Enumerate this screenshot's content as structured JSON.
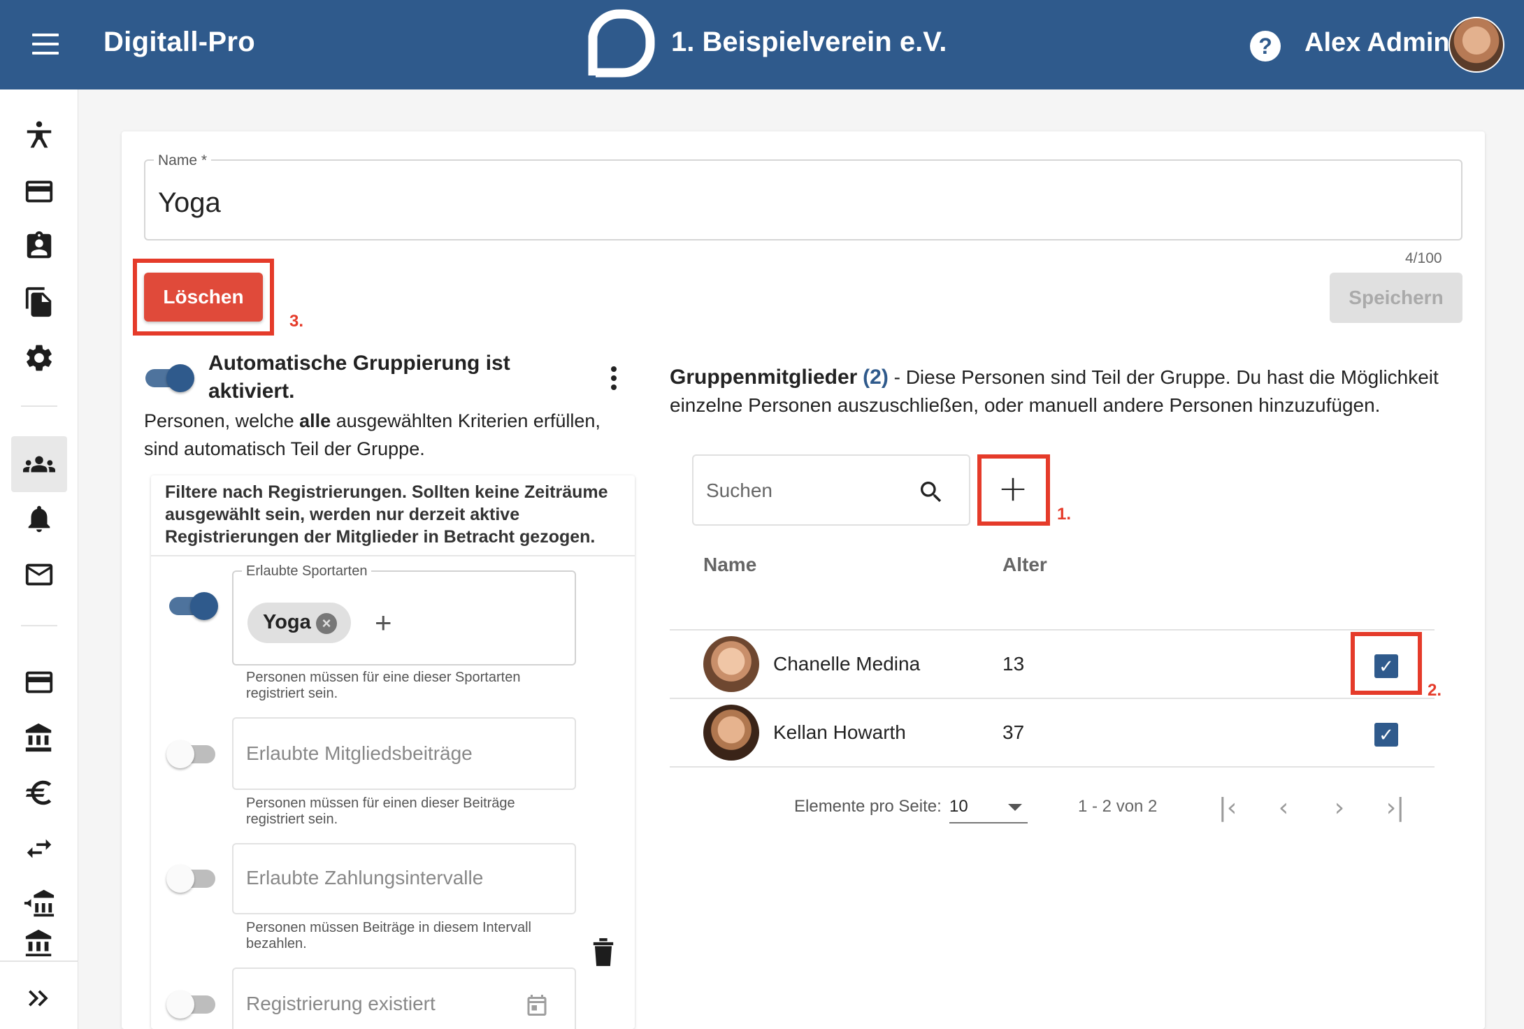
{
  "header": {
    "app_title": "Digitall-Pro",
    "club_name": "1. Beispielverein e.V.",
    "user_name": "Alex Admin",
    "help_symbol": "?",
    "brand_color": "#2f5a8c"
  },
  "sidebar": {
    "items": [
      {
        "icon": "sport-person-icon"
      },
      {
        "icon": "credit-card-icon"
      },
      {
        "icon": "contact-badge-icon"
      },
      {
        "icon": "documents-icon"
      },
      {
        "icon": "gear-icon"
      },
      {
        "icon": "groups-icon",
        "active": true
      },
      {
        "icon": "bell-icon"
      },
      {
        "icon": "mail-icon"
      },
      {
        "icon": "credit-card-icon"
      },
      {
        "icon": "bank-icon"
      },
      {
        "icon": "euro-icon"
      },
      {
        "icon": "transfer-arrows-icon"
      },
      {
        "icon": "bank-import-icon"
      },
      {
        "icon": "bank-export-icon"
      }
    ],
    "expand_icon": "double-chevron-right-icon"
  },
  "form": {
    "name_label": "Name *",
    "name_value": "Yoga",
    "counter": "4/100",
    "delete_label": "Löschen",
    "save_label": "Speichern"
  },
  "annotations": {
    "add": "1.",
    "checkbox": "2.",
    "delete": "3.",
    "color": "#e53b2a"
  },
  "auto_grouping": {
    "enabled": true,
    "title": "Automatische Gruppierung ist aktiviert.",
    "desc_pre": "Personen, welche ",
    "desc_bold": "alle",
    "desc_post": " ausgewählten Kriterien erfüllen, sind automatisch Teil der Gruppe.",
    "filter_note": "Filtere nach Registrierungen. Sollten keine Zeiträume ausgewählt sein, werden nur derzeit aktive Registrierungen der Mitglieder in Betracht gezogen.",
    "filters": [
      {
        "label": "Erlaubte Sportarten",
        "enabled": true,
        "chips": [
          "Yoga"
        ],
        "hint": "Personen müssen für eine dieser Sportarten registriert sein."
      },
      {
        "placeholder": "Erlaubte Mitgliedsbeiträge",
        "enabled": false,
        "hint": "Personen müssen für einen dieser Beiträge registriert sein."
      },
      {
        "placeholder": "Erlaubte Zahlungsintervalle",
        "enabled": false,
        "hint": "Personen müssen Beiträge in diesem Intervall bezahlen."
      },
      {
        "placeholder": "Registrierung existiert",
        "enabled": false
      }
    ]
  },
  "members": {
    "title": "Gruppenmitglieder",
    "count": "(2)",
    "description": " - Diese Personen sind Teil der Gruppe. Du hast die Möglichkeit einzelne Personen auszuschließen, oder manuell andere Personen hinzuzufügen.",
    "search_placeholder": "Suchen",
    "add_symbol": "+",
    "columns": [
      "Name",
      "Alter"
    ],
    "rows": [
      {
        "name": "Chanelle Medina",
        "age": "13",
        "checked": true
      },
      {
        "name": "Kellan Howarth",
        "age": "37",
        "checked": true
      }
    ],
    "pagination": {
      "per_page_label": "Elemente pro Seite:",
      "per_page_value": "10",
      "range": "1 - 2 von 2"
    }
  }
}
